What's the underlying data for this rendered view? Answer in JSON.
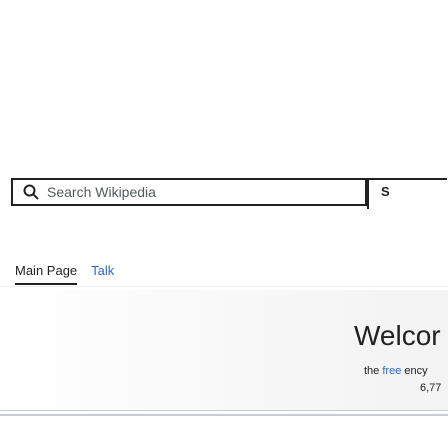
{
  "search": {
    "placeholder": "Search Wikipedia",
    "submit_label": "S"
  },
  "tabs": [
    {
      "label": "Main Page",
      "active": true
    },
    {
      "label": "Talk",
      "active": false
    }
  ],
  "welcome": {
    "title": "Welcor",
    "subtitle_prefix": "the ",
    "subtitle_link": "free",
    "subtitle_suffix": " ency",
    "article_count": "6,77"
  },
  "colors": {
    "text": "#202122",
    "link": "#3366cc",
    "border": "#202122",
    "divider": "#c8ccd1"
  }
}
